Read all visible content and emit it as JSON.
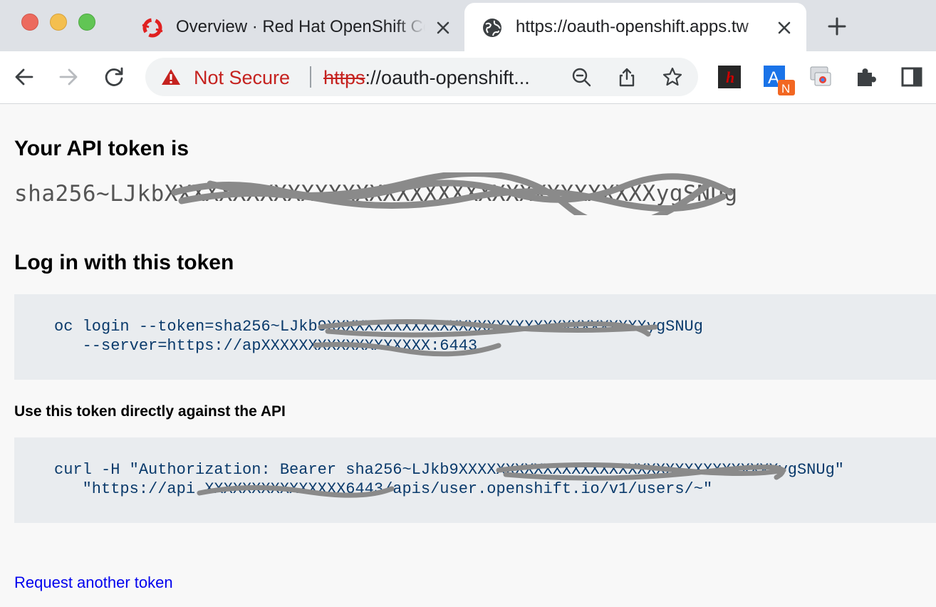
{
  "browser": {
    "tabs": [
      {
        "title": "Overview · Red Hat OpenShift Container Platform",
        "favicon": "openshift-icon",
        "active": false
      },
      {
        "title": "https://oauth-openshift.apps.tw",
        "favicon": "globe-icon",
        "active": true
      }
    ],
    "security_label": "Not Secure",
    "url_scheme": "https",
    "url_rest": "://oauth-openshift...",
    "extensions": [
      "hypothesis-icon",
      "translate-icon",
      "screen-share-icon",
      "puzzle-icon",
      "side-panel-icon"
    ],
    "translate_badge": "N"
  },
  "page": {
    "token_heading": "Your API token is",
    "token_value": "sha256~LJkbXXXXXXXXXXXXXXXXXXXXXXXXXXXXXXXXXXXXygSNUg",
    "login_heading": "Log in with this token",
    "login_command_line1": "oc login --token=sha256~LJkb9XXXXXXXXXXXXXXXXXXXXXXXXXXXXXXXXXXygSNUg",
    "login_command_line2": "   --server=https://apXXXXXXXXXXXXXXXXXX:6443",
    "api_heading": "Use this token directly against the API",
    "curl_command_line1": "curl -H \"Authorization: Bearer sha256~LJkb9XXXXXXXXXXXXXXXXXXXXXXXXXXXXXXXXXXygSNUg\"",
    "curl_command_line2": "   \"https://api.XXXXXXXXXXXXXXX6443/apis/user.openshift.io/v1/users/~\"",
    "request_link": "Request another token"
  },
  "colors": {
    "not_secure": "#c5221f",
    "code_text": "#0a3a6b",
    "link": "#0000ee"
  }
}
